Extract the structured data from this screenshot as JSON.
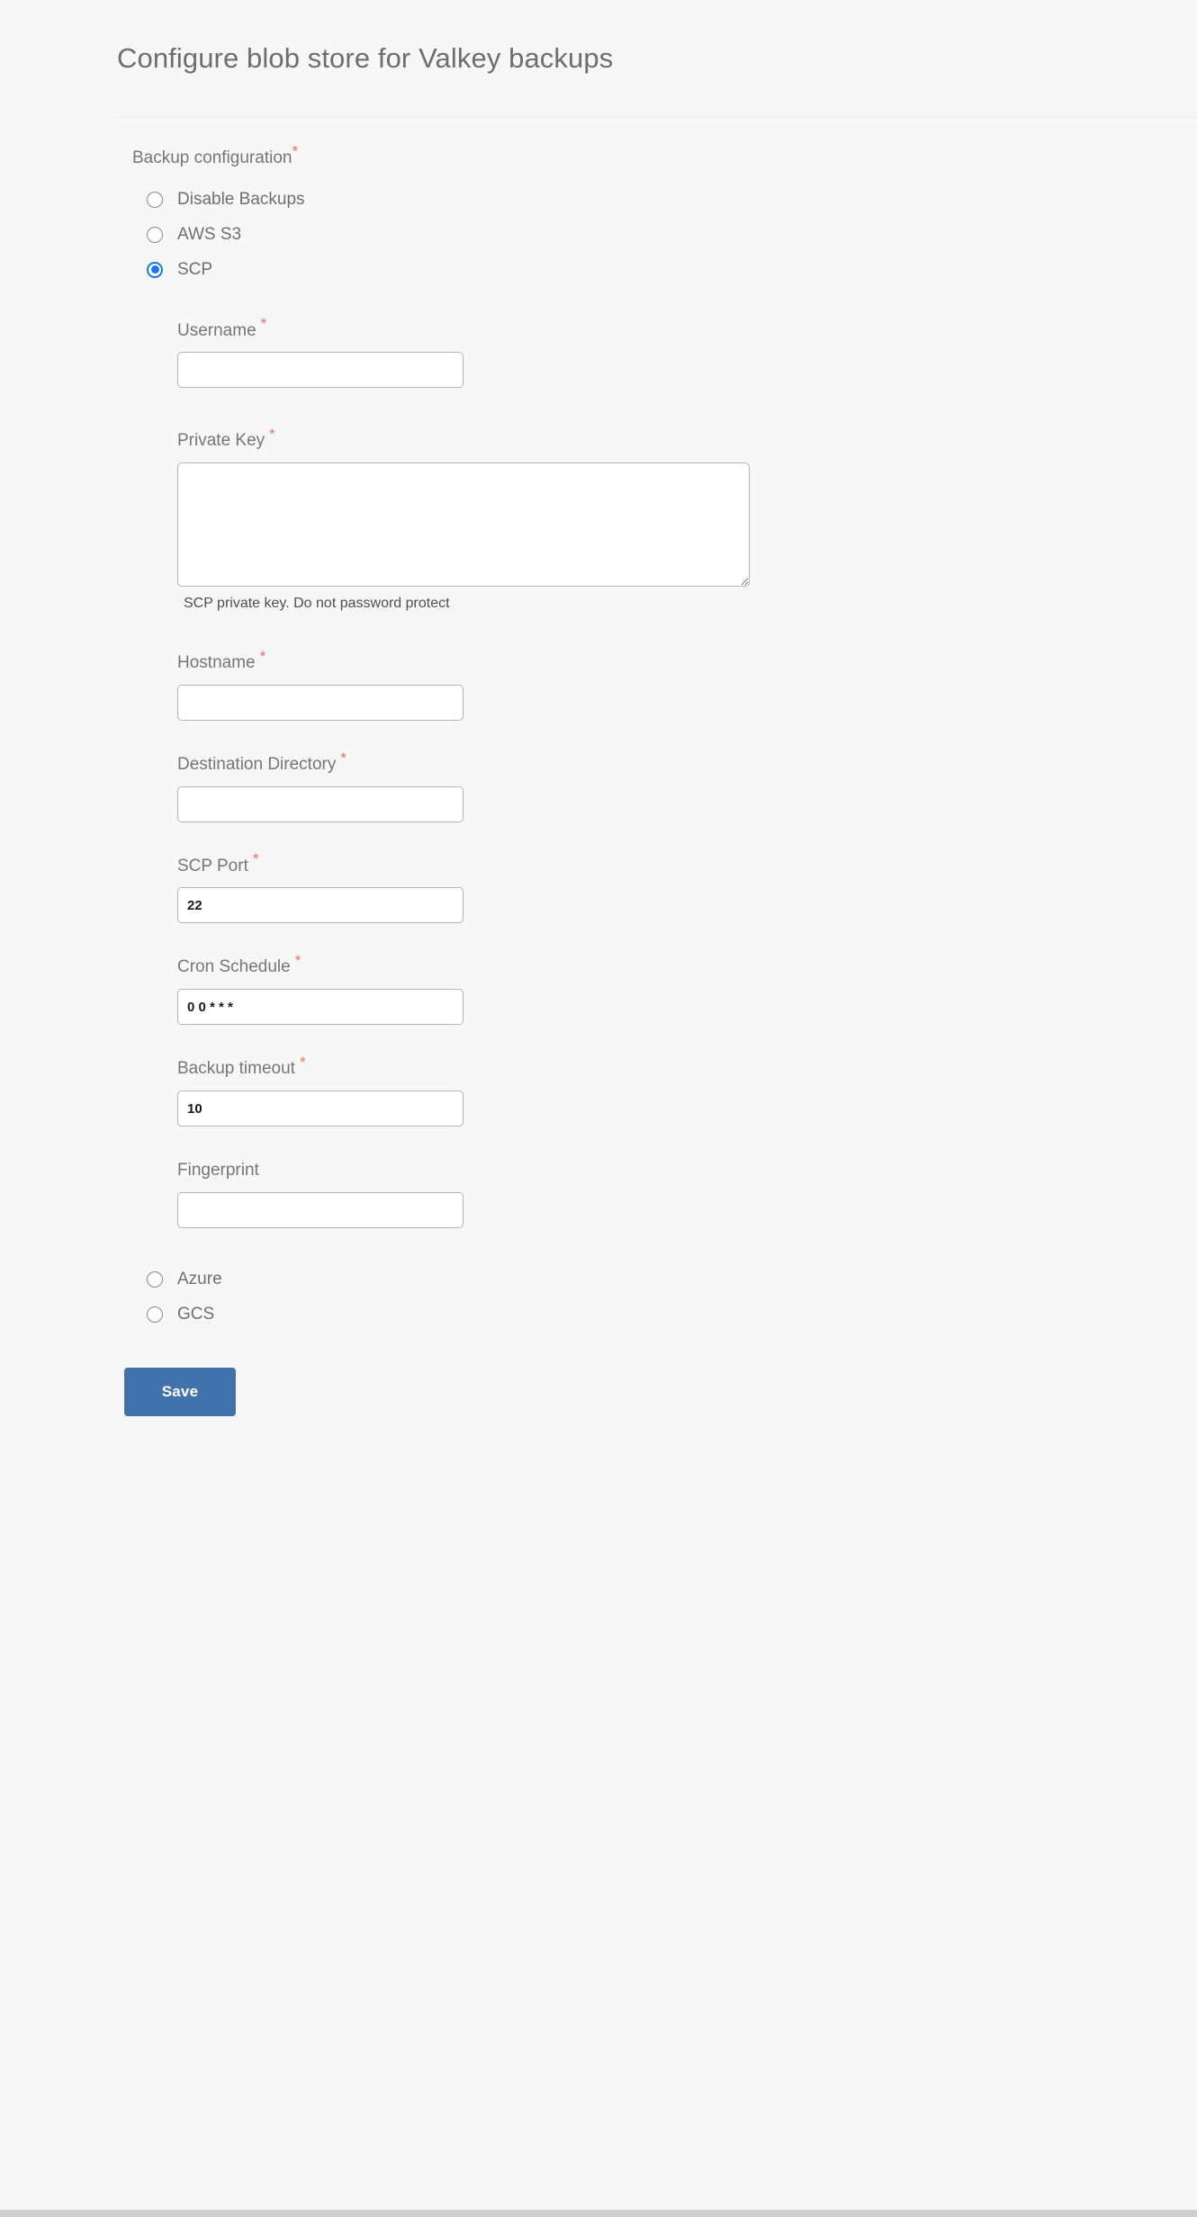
{
  "header": {
    "title": "Configure blob store for Valkey backups"
  },
  "form": {
    "group_label": "Backup configuration",
    "required_marker": "*",
    "options": [
      {
        "label": "Disable Backups",
        "selected": false
      },
      {
        "label": "AWS S3",
        "selected": false
      },
      {
        "label": "SCP",
        "selected": true
      },
      {
        "label": "Azure",
        "selected": false
      },
      {
        "label": "GCS",
        "selected": false
      }
    ],
    "scp_fields": {
      "username": {
        "label": "Username",
        "required": true,
        "value": "",
        "placeholder": ""
      },
      "private_key": {
        "label": "Private Key",
        "required": true,
        "value": "",
        "placeholder": "",
        "help": "SCP private key. Do not password protect"
      },
      "hostname": {
        "label": "Hostname",
        "required": true,
        "value": "",
        "placeholder": ""
      },
      "destination_directory": {
        "label": "Destination Directory",
        "required": true,
        "value": "",
        "placeholder": ""
      },
      "scp_port": {
        "label": "SCP Port",
        "required": true,
        "value": "22",
        "placeholder": ""
      },
      "cron_schedule": {
        "label": "Cron Schedule",
        "required": true,
        "value": "0 0 * * *",
        "placeholder": ""
      },
      "backup_timeout": {
        "label": "Backup timeout",
        "required": true,
        "value": "10",
        "placeholder": ""
      },
      "fingerprint": {
        "label": "Fingerprint",
        "required": false,
        "value": "",
        "placeholder": ""
      }
    },
    "save_label": "Save"
  },
  "colors": {
    "accent_button": "#4272ab",
    "radio_selected": "#1677f2",
    "required_asterisk": "#ef6b60",
    "page_background": "#f7f7f7"
  }
}
